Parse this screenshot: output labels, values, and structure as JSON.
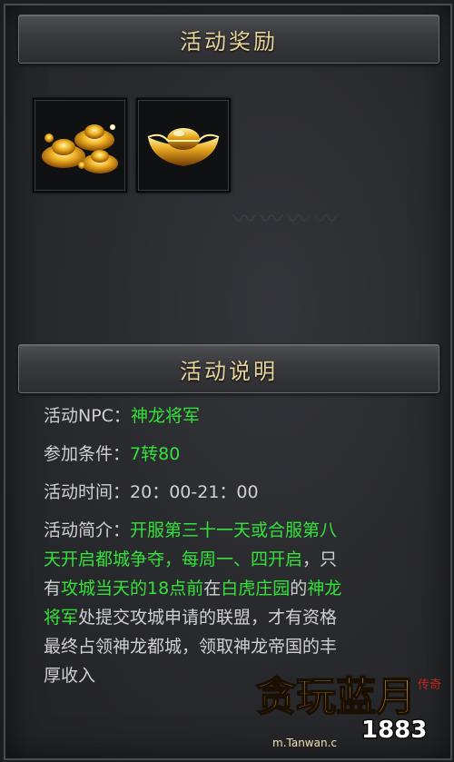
{
  "reward": {
    "title": "活动奖励",
    "items": [
      {
        "icon": "gold-ingots-pile-icon"
      },
      {
        "icon": "gold-ingot-icon"
      }
    ]
  },
  "description": {
    "title": "活动说明",
    "npc_label": "活动NPC：",
    "npc_value": "神龙将军",
    "condition_label": "参加条件：",
    "condition_value": "7转80",
    "time_label": "活动时间：",
    "time_value": "20：00-21：00",
    "intro_label": "活动简介：",
    "intro_lines": [
      [
        {
          "t": "开服第三十一天或合服第八",
          "c": "green"
        }
      ],
      [
        {
          "t": "天开启都城争夺，每周一、四开启",
          "c": "green"
        },
        {
          "t": "，只",
          "c": "white"
        }
      ],
      [
        {
          "t": "有",
          "c": "white"
        },
        {
          "t": "攻城当天的18点前",
          "c": "green"
        },
        {
          "t": "在",
          "c": "white"
        },
        {
          "t": "白虎庄园",
          "c": "green"
        },
        {
          "t": "的",
          "c": "white"
        },
        {
          "t": "神龙",
          "c": "green"
        }
      ],
      [
        {
          "t": "将军",
          "c": "green"
        },
        {
          "t": "处提交攻城申请的联盟，才有资格",
          "c": "white"
        }
      ],
      [
        {
          "t": "最终占领神龙都城，领取神龙帝国的丰",
          "c": "white"
        }
      ],
      [
        {
          "t": "厚收入",
          "c": "white"
        }
      ]
    ]
  },
  "watermark": {
    "brand": "贪玩蓝月",
    "sub": "传奇",
    "number": "1883",
    "site": "m.Tanwan.c"
  },
  "colors": {
    "header_text": "#e8d39a",
    "highlight": "#35e23a",
    "body_text": "#d0d0d0"
  }
}
